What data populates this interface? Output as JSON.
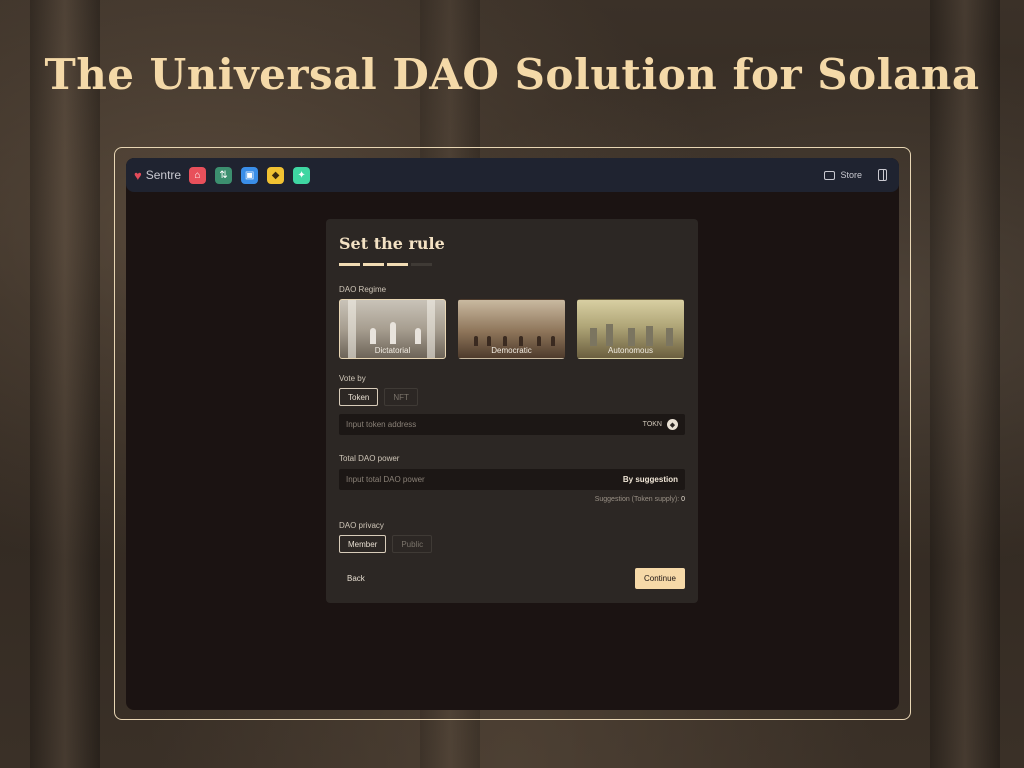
{
  "hero": {
    "title": "The Universal DAO Solution for Solana"
  },
  "topbar": {
    "brand": "Sentre",
    "apps": [
      {
        "icon": "home-app-icon",
        "color": "#e8505b",
        "glyph": "⌂"
      },
      {
        "icon": "swap-app-icon",
        "color": "#3c8f6f",
        "glyph": "⇅"
      },
      {
        "icon": "wallet-app-icon",
        "color": "#3a8ee8",
        "glyph": "▣"
      },
      {
        "icon": "farm-app-icon",
        "color": "#f1c232",
        "glyph": "◆"
      },
      {
        "icon": "sparkle-app-icon",
        "color": "#3fd6a2",
        "glyph": "✦"
      }
    ],
    "store_label": "Store"
  },
  "form": {
    "title": "Set the rule",
    "steps_total": 4,
    "steps_done": 3,
    "regime_label": "DAO Regime",
    "regimes": [
      "Dictatorial",
      "Democratic",
      "Autonomous"
    ],
    "regime_selected": "Dictatorial",
    "vote_label": "Vote by",
    "vote_options": [
      "Token",
      "NFT"
    ],
    "vote_selected": "Token",
    "token_placeholder": "Input token address",
    "token_symbol": "TOKN",
    "power_label": "Total DAO power",
    "power_placeholder": "Input total DAO power",
    "power_action": "By suggestion",
    "suggestion_text": "Suggestion (Token supply):",
    "suggestion_value": "0",
    "privacy_label": "DAO privacy",
    "privacy_options": [
      "Member",
      "Public"
    ],
    "privacy_selected": "Member",
    "back_label": "Back",
    "continue_label": "Continue"
  }
}
